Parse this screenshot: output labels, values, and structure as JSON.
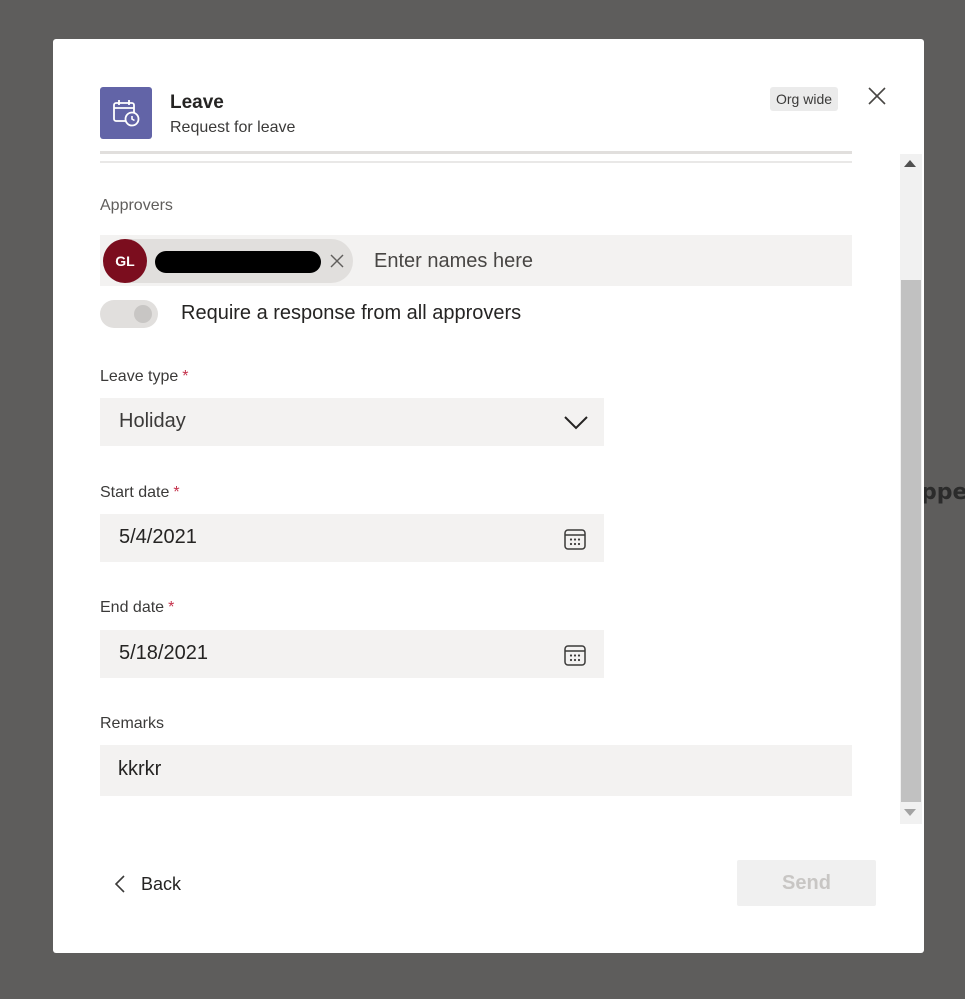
{
  "background": {
    "partial_text": "ppe"
  },
  "header": {
    "app_title": "Leave",
    "app_subtitle": "Request for leave",
    "badge": "Org wide",
    "icon": "calendar-clock-icon",
    "accent_color": "#6264a7"
  },
  "approvers": {
    "label": "Approvers",
    "chips": [
      {
        "initials": "GL",
        "avatar_color": "#7b0d1e"
      }
    ],
    "input_placeholder": "Enter names here"
  },
  "require_all": {
    "label": "Require a response from all approvers",
    "enabled": false
  },
  "leave_type": {
    "label": "Leave type",
    "required_mark": "*",
    "value": "Holiday"
  },
  "start_date": {
    "label": "Start date",
    "required_mark": "*",
    "value": "5/4/2021"
  },
  "end_date": {
    "label": "End date",
    "required_mark": "*",
    "value": "5/18/2021"
  },
  "remarks": {
    "label": "Remarks",
    "value": "kkrkr"
  },
  "footer": {
    "back_label": "Back",
    "send_label": "Send"
  }
}
